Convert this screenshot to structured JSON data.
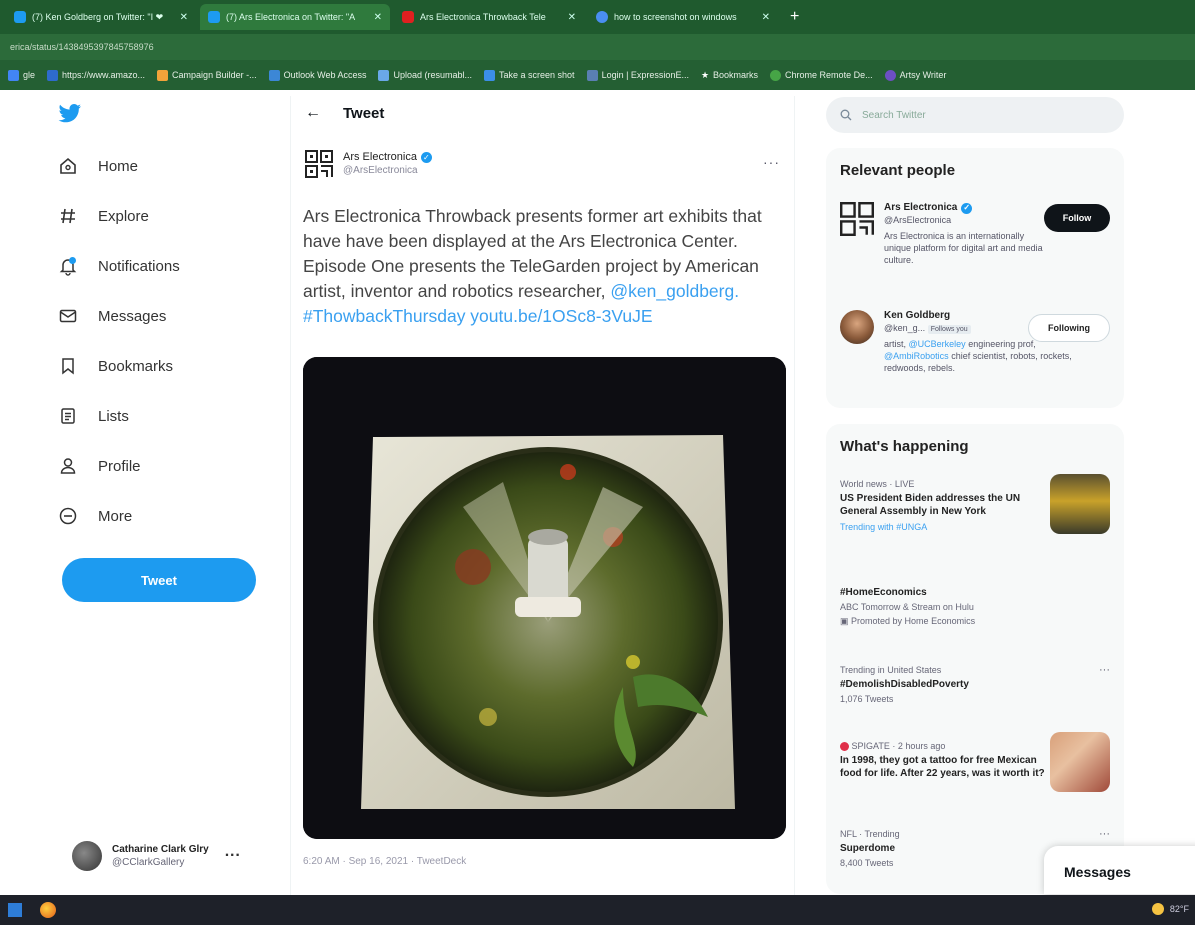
{
  "browser": {
    "tabs": [
      {
        "label": "(7) Ken Goldberg on Twitter: \"I ❤ ",
        "color": "#1d9bf0",
        "active": false
      },
      {
        "label": "(7) Ars Electronica on Twitter: \"A",
        "color": "#1d9bf0",
        "active": true
      },
      {
        "label": "Ars Electronica Throwback Tele",
        "color": "#e02020",
        "active": false
      },
      {
        "label": "how to screenshot on windows",
        "color": "#4a8ef0",
        "active": false
      }
    ],
    "url": "erica/status/1438495397845758976",
    "bookmarks": [
      {
        "label": "gle",
        "color": "#4285f4"
      },
      {
        "label": "https://www.amazo...",
        "color": "#2e6bcc"
      },
      {
        "label": "Campaign Builder -...",
        "color": "#f2a33a"
      },
      {
        "label": "Outlook Web Access",
        "color": "#3c87d6"
      },
      {
        "label": "Upload (resumabl...",
        "color": "#6aa8e8"
      },
      {
        "label": "Take a screen shot",
        "color": "#3b8ee8"
      },
      {
        "label": "Login | ExpressionE...",
        "color": "#5a7fb3"
      },
      {
        "label": "Bookmarks",
        "color": "#e8c34a"
      },
      {
        "label": "Chrome Remote De...",
        "color": "#46a546"
      },
      {
        "label": "Artsy Writer",
        "color": "#6c4fc2"
      }
    ]
  },
  "nav": {
    "items": [
      {
        "label": "Home",
        "icon": "home-icon"
      },
      {
        "label": "Explore",
        "icon": "hashtag-icon"
      },
      {
        "label": "Notifications",
        "icon": "bell-icon"
      },
      {
        "label": "Messages",
        "icon": "envelope-icon"
      },
      {
        "label": "Bookmarks",
        "icon": "bookmark-icon"
      },
      {
        "label": "Lists",
        "icon": "list-icon"
      },
      {
        "label": "Profile",
        "icon": "person-icon"
      },
      {
        "label": "More",
        "icon": "more-circle-icon"
      }
    ],
    "tweet_button": "Tweet",
    "account": {
      "name": "Catharine Clark Glry",
      "handle": "@CClarkGallery"
    }
  },
  "main": {
    "header": "Tweet",
    "author": {
      "name": "Ars Electronica",
      "handle": "@ArsElectronica"
    },
    "text_plain": "Ars Electronica Throwback presents former art exhibits that have have been displayed at the Ars Electronica Center. Episode One presents the TeleGarden project by American artist, inventor and robotics researcher,",
    "text_links": "@ken_goldberg. #ThowbackThursday youtu.be/1OSc8-3VuJE",
    "timestamp": "6:20 AM · Sep 16, 2021 · TweetDeck"
  },
  "right": {
    "search_placeholder": "Search Twitter",
    "relevant_title": "Relevant people",
    "people": [
      {
        "name": "Ars Electronica",
        "handle": "@ArsElectronica",
        "bio": "Ars Electronica is an internationally unique platform for digital art and media culture.",
        "button": "Follow"
      },
      {
        "name": "Ken Goldberg",
        "handle": "@ken_g...",
        "follows_you": "Follows you",
        "bio_pre": "artist,",
        "bio_link1": "@UCBerkeley",
        "bio_mid": "engineering prof,",
        "bio_link2": "@AmbiRobotics",
        "bio_post": "chief scientist, robots, rockets, redwoods, rebels.",
        "button": "Following"
      }
    ],
    "happening_title": "What's happening",
    "trends": [
      {
        "meta": "World news · LIVE",
        "title": "US President Biden addresses the UN General Assembly in New York",
        "sub": "Trending with #UNGA"
      },
      {
        "meta": "",
        "title": "#HomeEconomics",
        "sub": "ABC Tomorrow & Stream on Hulu",
        "sub2": "Promoted by Home Economics"
      },
      {
        "meta": "Trending in United States",
        "title": "#DemolishDisabledPoverty",
        "sub": "1,076 Tweets"
      },
      {
        "meta": "SPIGATE · 2 hours ago",
        "title": "In 1998, they got a tattoo for free Mexican food for life. After 22 years, was it worth it?",
        "sub": ""
      },
      {
        "meta": "NFL · Trending",
        "title": "Superdome",
        "sub": "8,400 Tweets"
      }
    ],
    "messages_label": "Messages"
  },
  "taskbar": {
    "weather": "82°F"
  }
}
